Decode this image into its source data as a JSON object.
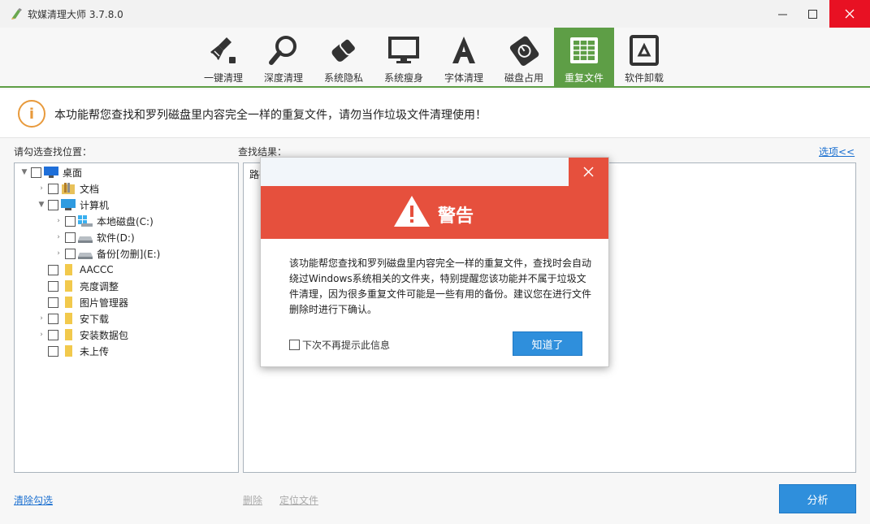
{
  "window": {
    "title": "软媒清理大师 3.7.8.0",
    "controls": {
      "minimize": "—",
      "maximize": "☐",
      "close": "✕"
    }
  },
  "toolbar": {
    "items": [
      {
        "label": "一键清理",
        "icon": "broom-icon"
      },
      {
        "label": "深度清理",
        "icon": "magnifier-icon"
      },
      {
        "label": "系统隐私",
        "icon": "eraser-icon"
      },
      {
        "label": "系统瘦身",
        "icon": "monitor-icon"
      },
      {
        "label": "字体清理",
        "icon": "font-icon"
      },
      {
        "label": "磁盘占用",
        "icon": "disk-usage-icon"
      },
      {
        "label": "重复文件",
        "icon": "duplicate-files-icon",
        "active": true
      },
      {
        "label": "软件卸载",
        "icon": "recycle-icon"
      }
    ]
  },
  "notice": {
    "icon": "info-icon",
    "text": "本功能帮您查找和罗列磁盘里内容完全一样的重复文件，请勿当作垃圾文件清理使用！"
  },
  "left": {
    "header": "请勾选查找位置：",
    "tree": [
      {
        "label": "桌面",
        "level": 0,
        "expanded": true,
        "icon": "desktop-icon"
      },
      {
        "label": "文档",
        "level": 1,
        "expanded": false,
        "icon": "documents-folder-icon"
      },
      {
        "label": "计算机",
        "level": 1,
        "expanded": true,
        "icon": "computer-icon"
      },
      {
        "label": "本地磁盘(C:)",
        "level": 2,
        "expanded": false,
        "icon": "windows-drive-icon"
      },
      {
        "label": "软件(D:)",
        "level": 2,
        "expanded": false,
        "icon": "drive-icon"
      },
      {
        "label": "备份[勿删](E:)",
        "level": 2,
        "expanded": false,
        "icon": "drive-icon"
      },
      {
        "label": "AACCC",
        "level": 1,
        "icon": "folder-icon"
      },
      {
        "label": "亮度调整",
        "level": 1,
        "icon": "folder-icon"
      },
      {
        "label": "图片管理器",
        "level": 1,
        "icon": "folder-icon"
      },
      {
        "label": "安下载",
        "level": 1,
        "expanded": false,
        "icon": "folder-icon"
      },
      {
        "label": "安装数据包",
        "level": 1,
        "expanded": false,
        "icon": "folder-icon"
      },
      {
        "label": "未上传",
        "level": 1,
        "icon": "folder-icon"
      }
    ]
  },
  "right": {
    "header": "查找结果：",
    "options_link": "选项<<",
    "column_path": "路径"
  },
  "bottom": {
    "clear_link": "清除勾选",
    "delete_link": "删除",
    "locate_link": "定位文件",
    "analyze_button": "分析"
  },
  "dialog": {
    "title": "警告",
    "close": "✕",
    "message": "该功能帮您查找和罗列磁盘里内容完全一样的重复文件，查找时会自动绕过Windows系统相关的文件夹，特别提醒您该功能并不属于垃圾文件清理，因为很多重复文件可能是一些有用的备份。建议您在进行文件删除时进行下确认。",
    "dont_show_label": "下次不再提示此信息",
    "ok_button": "知道了"
  },
  "colors": {
    "accent_green": "#5e9e46",
    "button_blue": "#2f8fdc",
    "warning_red": "#e6503d",
    "info_orange": "#e89a3c"
  }
}
